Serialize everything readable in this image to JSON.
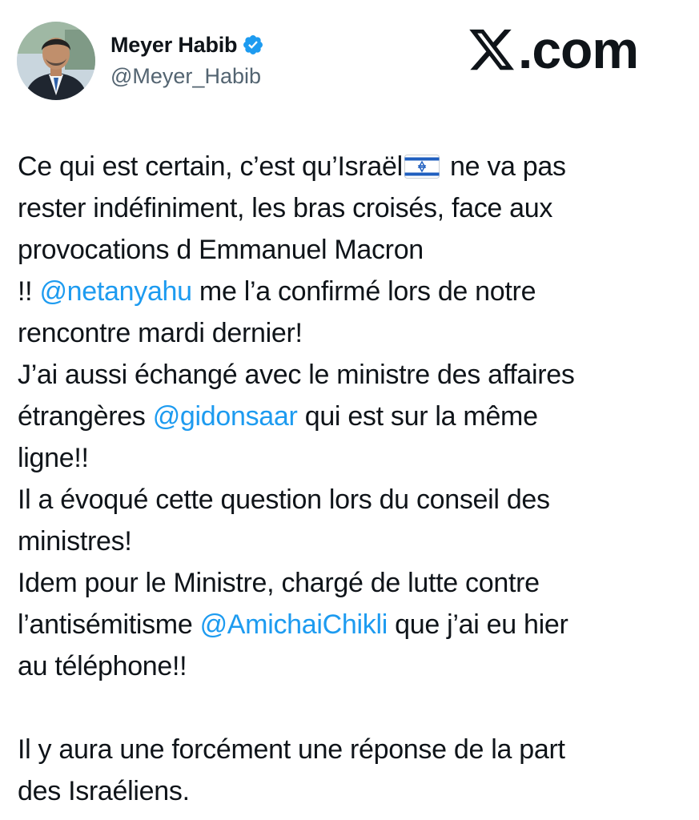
{
  "author": {
    "display_name": "Meyer Habib",
    "handle": "@Meyer_Habib",
    "verified_icon": "verified-badge-icon",
    "avatar_icon": "profile-photo"
  },
  "brand": {
    "logo_icon": "x-logo-icon",
    "text": ".com"
  },
  "colors": {
    "link": "#1d9bf0",
    "text": "#0f1419",
    "muted": "#536471",
    "verified": "#1d9bf0"
  },
  "tweet": {
    "l1a": "Ce qui est certain, c’est qu’Israël",
    "flag_icon": "israel-flag-emoji",
    "l1b": " ne va pas",
    "l2": "rester indéfiniment, les bras croisés, face aux",
    "l3": "provocations d Emmanuel Macron",
    "l4a": "!! ",
    "m1": "@netanyahu",
    "l4b": " me l’a confirmé lors de notre",
    "l5": "rencontre mardi dernier!",
    "l6": "J’ai aussi échangé avec le ministre des affaires",
    "l7a": "étrangères ",
    "m2": "@gidonsaar",
    "l7b": " qui est sur la même",
    "l8": "ligne!!",
    "l9": "Il a évoqué cette question lors du conseil des",
    "l10": "ministres!",
    "l11": "Idem pour le Ministre, chargé de lutte contre",
    "l12a": "l’antisémitisme ",
    "m3": "@AmichaiChikli",
    "l12b": " que j’ai eu hier",
    "l13": "au téléphone!!",
    "l14": "Il y aura une forcément une réponse  de la part",
    "l15": "des Israéliens."
  }
}
